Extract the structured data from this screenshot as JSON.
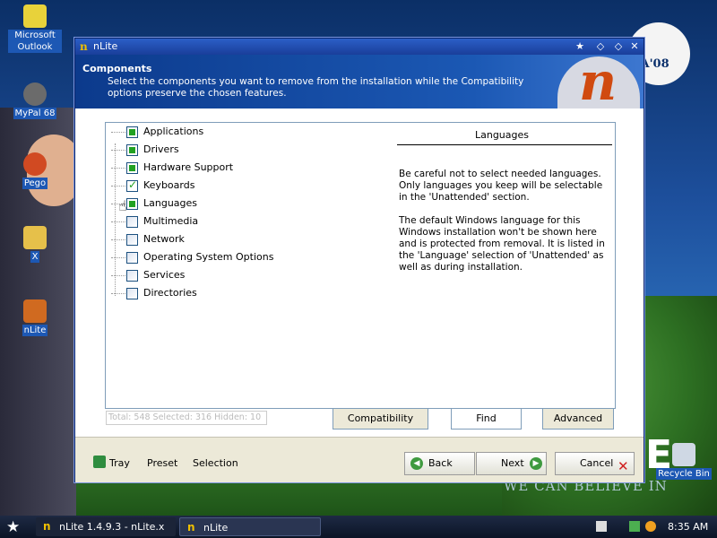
{
  "desktop": {
    "icons": [
      {
        "name": "microsoft-outlook",
        "label": "Microsoft Outlook",
        "color": "#e8d23a"
      },
      {
        "name": "mypal",
        "label": "MyPal 68",
        "color": "#6b6b6b"
      },
      {
        "name": "pego",
        "label": "Pego",
        "color": "#d14a22"
      },
      {
        "name": "x-folder",
        "label": "X",
        "color": "#e6c04a"
      },
      {
        "name": "nlite-shortcut",
        "label": "nLite",
        "color": "#d06a20"
      },
      {
        "name": "recycle-bin",
        "label": "Recycle Bin",
        "color": "#cfd8e4"
      }
    ],
    "wallpaper": {
      "logo_text": "AMA'08",
      "slogan": "WE CAN BELIEVE IN",
      "big_letter": "E"
    }
  },
  "window": {
    "title": "nLite",
    "header_title": "Components",
    "header_desc": "Select the components you want to remove from the installation while the Compatibility options preserve the chosen features.",
    "logo_letter": "n",
    "tree": [
      {
        "label": "Applications",
        "state": "filled"
      },
      {
        "label": "Drivers",
        "state": "filled"
      },
      {
        "label": "Hardware Support",
        "state": "filled"
      },
      {
        "label": "Keyboards",
        "state": "checked"
      },
      {
        "label": "Languages",
        "state": "filled"
      },
      {
        "label": "Multimedia",
        "state": "empty"
      },
      {
        "label": "Network",
        "state": "empty"
      },
      {
        "label": "Operating System Options",
        "state": "empty"
      },
      {
        "label": "Services",
        "state": "empty"
      },
      {
        "label": "Directories",
        "state": "empty"
      }
    ],
    "info": {
      "title": "Languages",
      "para1": "Be careful not to select needed languages. Only languages you keep will be selectable in the 'Unattended' section.",
      "para2": "The default Windows language for this Windows installation won't be shown here and is protected from removal. It is listed in the 'Language' selection of 'Unattended' as well as during installation."
    },
    "status_text": "Total: 548 Selected: 316 Hidden: 10",
    "tabs": {
      "compatibility": "Compatibility",
      "find": "Find",
      "advanced": "Advanced"
    },
    "footer": {
      "tray": "Tray",
      "preset": "Preset",
      "selection": "Selection",
      "back": "Back",
      "next": "Next",
      "cancel": "Cancel"
    }
  },
  "taskbar": {
    "buttons": [
      {
        "label": "nLite 1.4.9.3 - nLite.x"
      },
      {
        "label": "nLite"
      }
    ],
    "clock": "8:35 AM"
  },
  "colors": {
    "accent": "#1b58b4",
    "check_green": "#21a121",
    "cancel_red": "#d02020"
  }
}
